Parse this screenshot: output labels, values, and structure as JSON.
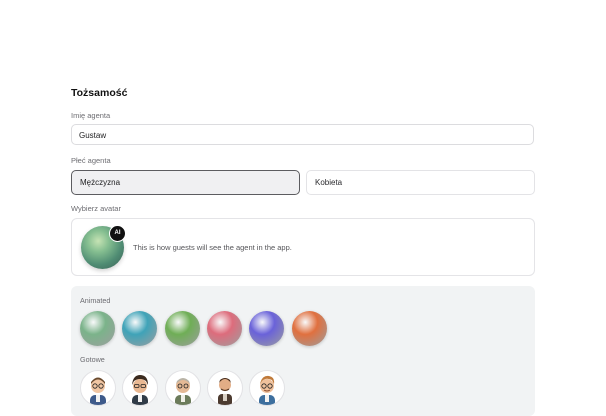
{
  "identity": {
    "title": "Tożsamość"
  },
  "agent_name": {
    "label": "Imię agenta",
    "value": "Gustaw"
  },
  "agent_gender": {
    "label": "Płeć agenta",
    "options": [
      "Mężczyzna",
      "Kobieta"
    ],
    "selected": "Mężczyzna"
  },
  "avatar": {
    "label": "Wybierz avatar",
    "badge": "AI",
    "description": "This is how guests will see the agent in the app.",
    "animated_label": "Animated",
    "animated_colors": [
      "#7bb38a",
      "#3fa3b8",
      "#6fae56",
      "#dd6c7c",
      "#6a62d9",
      "#e0703f"
    ],
    "ready_label": "Gotowe"
  }
}
